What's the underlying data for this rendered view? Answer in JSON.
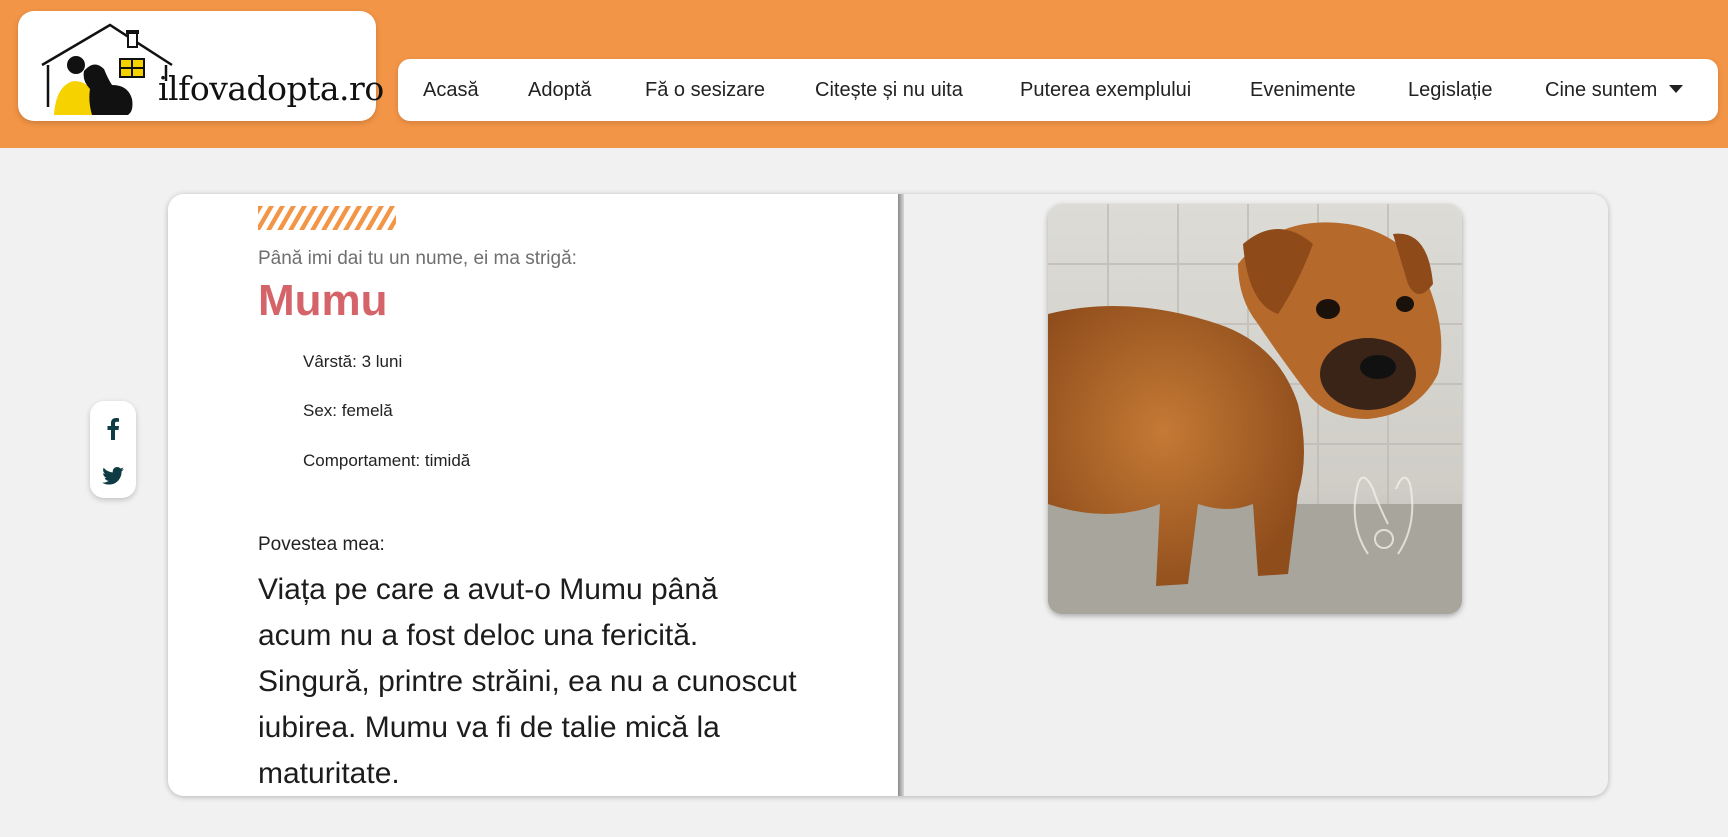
{
  "header": {
    "logo_text": "ilfovadopta.ro",
    "nav": [
      {
        "label": "Acasă"
      },
      {
        "label": "Adoptă"
      },
      {
        "label": "Fă o sesizare"
      },
      {
        "label": "Citește și nu uita"
      },
      {
        "label": "Puterea exemplului"
      },
      {
        "label": "Evenimente"
      },
      {
        "label": "Legislație"
      },
      {
        "label": "Cine suntem",
        "icon": "caret-down-icon"
      }
    ]
  },
  "social": [
    {
      "icon": "facebook-icon"
    },
    {
      "icon": "twitter-icon"
    }
  ],
  "pet": {
    "intro": "Până imi dai tu un nume, ei ma strigă:",
    "name": "Mumu",
    "attributes": [
      "Vârstă: 3 luni",
      "Sex: femelă",
      "Comportament: timidă"
    ],
    "story_label": "Povestea mea:",
    "story": "Viața pe care a avut-o Mumu până acum nu a fost deloc una fericită. Singură, printre străini, ea nu a cunoscut iubirea. Mumu va fi de talie mică la maturitate."
  },
  "colors": {
    "header_bg": "#f39547",
    "name": "#d5646a",
    "accent_stripes": "#f39547"
  }
}
